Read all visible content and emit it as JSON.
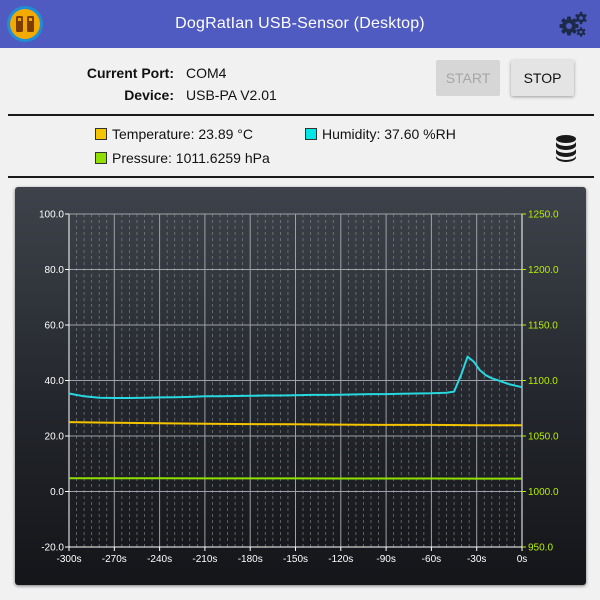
{
  "window": {
    "title": "DogRatIan USB-Sensor (Desktop)"
  },
  "icons": {
    "logo": "app-logo-icon",
    "settings": "gears-icon",
    "database": "database-icon"
  },
  "info": {
    "port_label": "Current Port:",
    "port_value": "COM4",
    "device_label": "Device:",
    "device_value": "USB-PA V2.01"
  },
  "buttons": {
    "start_label": "START",
    "start_enabled": false,
    "stop_label": "STOP"
  },
  "readings": [
    {
      "id": "temperature",
      "text": "Temperature: 23.89 °C",
      "color": "#f5c400"
    },
    {
      "id": "humidity",
      "text": "Humidity: 37.60 %RH",
      "color": "#00e5e5"
    },
    {
      "id": "pressure",
      "text": "Pressure: 1011.6259 hPa",
      "color": "#8fe000"
    }
  ],
  "chart_data": {
    "type": "line",
    "x_ticks": [
      "-300s",
      "-270s",
      "-240s",
      "-210s",
      "-180s",
      "-150s",
      "-120s",
      "-90s",
      "-60s",
      "-30s",
      "0s"
    ],
    "y_left_ticks": [
      "100.0",
      "80.0",
      "60.0",
      "40.0",
      "20.0",
      "0.0",
      "-20.0"
    ],
    "y_right_ticks": [
      "1250.0",
      "1200.0",
      "1150.0",
      "1100.0",
      "1050.0",
      "1000.0",
      "950.0"
    ],
    "xlim": [
      -300,
      0
    ],
    "ylim_left": [
      -20,
      100
    ],
    "ylim_right": [
      950,
      1250
    ],
    "grid": true,
    "series": [
      {
        "name": "Temperature",
        "axis": "left",
        "color": "#f5c400",
        "x": [
          -300,
          -270,
          -240,
          -210,
          -180,
          -150,
          -120,
          -90,
          -60,
          -30,
          0
        ],
        "y": [
          25.0,
          24.8,
          24.6,
          24.4,
          24.3,
          24.2,
          24.1,
          24.0,
          24.0,
          23.9,
          23.9
        ]
      },
      {
        "name": "Humidity",
        "axis": "left",
        "color": "#27d8e0",
        "x": [
          -300,
          -290,
          -280,
          -270,
          -260,
          -250,
          -240,
          -230,
          -220,
          -210,
          -200,
          -190,
          -180,
          -170,
          -160,
          -150,
          -140,
          -130,
          -120,
          -110,
          -100,
          -90,
          -80,
          -70,
          -60,
          -50,
          -45,
          -40,
          -36,
          -32,
          -28,
          -24,
          -20,
          -16,
          -12,
          -8,
          -4,
          0
        ],
        "y": [
          35.3,
          34.3,
          33.8,
          33.7,
          33.7,
          33.8,
          33.9,
          34.0,
          34.1,
          34.3,
          34.3,
          34.4,
          34.5,
          34.6,
          34.6,
          34.7,
          34.8,
          34.8,
          34.9,
          35.0,
          35.1,
          35.1,
          35.2,
          35.3,
          35.4,
          35.6,
          36.0,
          42.5,
          48.6,
          46.8,
          43.8,
          41.9,
          40.8,
          40.1,
          39.3,
          38.6,
          38.1,
          37.6
        ]
      },
      {
        "name": "Pressure",
        "axis": "right",
        "color": "#8fe000",
        "x": [
          -300,
          -270,
          -240,
          -210,
          -180,
          -150,
          -120,
          -90,
          -60,
          -30,
          0
        ],
        "y": [
          1012.0,
          1011.9,
          1011.9,
          1011.8,
          1011.8,
          1011.8,
          1011.7,
          1011.7,
          1011.7,
          1011.6,
          1011.6
        ]
      }
    ]
  }
}
